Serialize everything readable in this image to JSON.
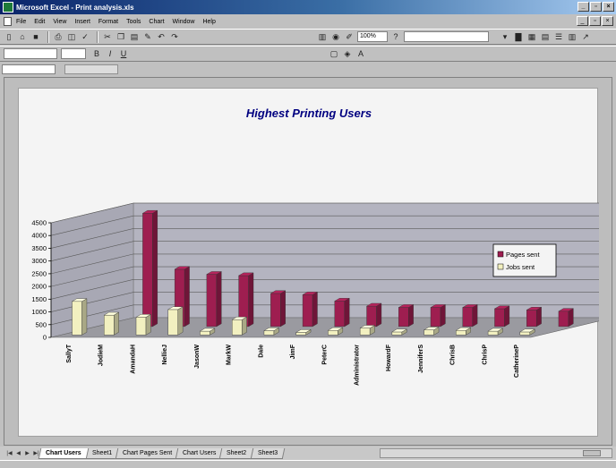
{
  "window": {
    "title": "Microsoft Excel - Print analysis.xls"
  },
  "menu": [
    "File",
    "Edit",
    "View",
    "Insert",
    "Format",
    "Tools",
    "Chart",
    "Window",
    "Help"
  ],
  "toolbar": {
    "zoom": "100%"
  },
  "sheet_tabs": [
    {
      "label": "Chart Users",
      "active": true
    },
    {
      "label": "Sheet1",
      "active": false
    },
    {
      "label": "Chart Pages Sent",
      "active": false
    },
    {
      "label": "Chart Users",
      "active": false
    },
    {
      "label": "Sheet2",
      "active": false
    },
    {
      "label": "Sheet3",
      "active": false
    }
  ],
  "colors": {
    "pages": "#9e1e50",
    "jobs": "#f2f0c0",
    "wall": "#b4b4c0",
    "floor": "#9a9aa0"
  },
  "chart_data": {
    "type": "bar",
    "title": "Highest Printing Users",
    "categories": [
      "SallyT",
      "JodieM",
      "AmandaH",
      "NellieJ",
      "JasonW",
      "MarkW",
      "Dale",
      "JimF",
      "PeterC",
      "Administrator",
      "HowardF",
      "JenniferS",
      "ChrisB",
      "ChrisP",
      "CatherineP"
    ],
    "series": [
      {
        "name": "Pages sent",
        "values": [
          0,
          4450,
          2250,
          2050,
          2000,
          1300,
          1250,
          1000,
          800,
          750,
          750,
          750,
          700,
          650,
          600
        ]
      },
      {
        "name": "Jobs sent",
        "values": [
          1320,
          780,
          700,
          1000,
          150,
          600,
          170,
          100,
          180,
          270,
          120,
          200,
          180,
          150,
          120
        ]
      }
    ],
    "ylim": [
      0,
      4500
    ],
    "yticks": [
      "0",
      "500",
      "1000",
      "1500",
      "2000",
      "2500",
      "3000",
      "3500",
      "4000",
      "4500"
    ],
    "grid": true,
    "legend": "right"
  }
}
